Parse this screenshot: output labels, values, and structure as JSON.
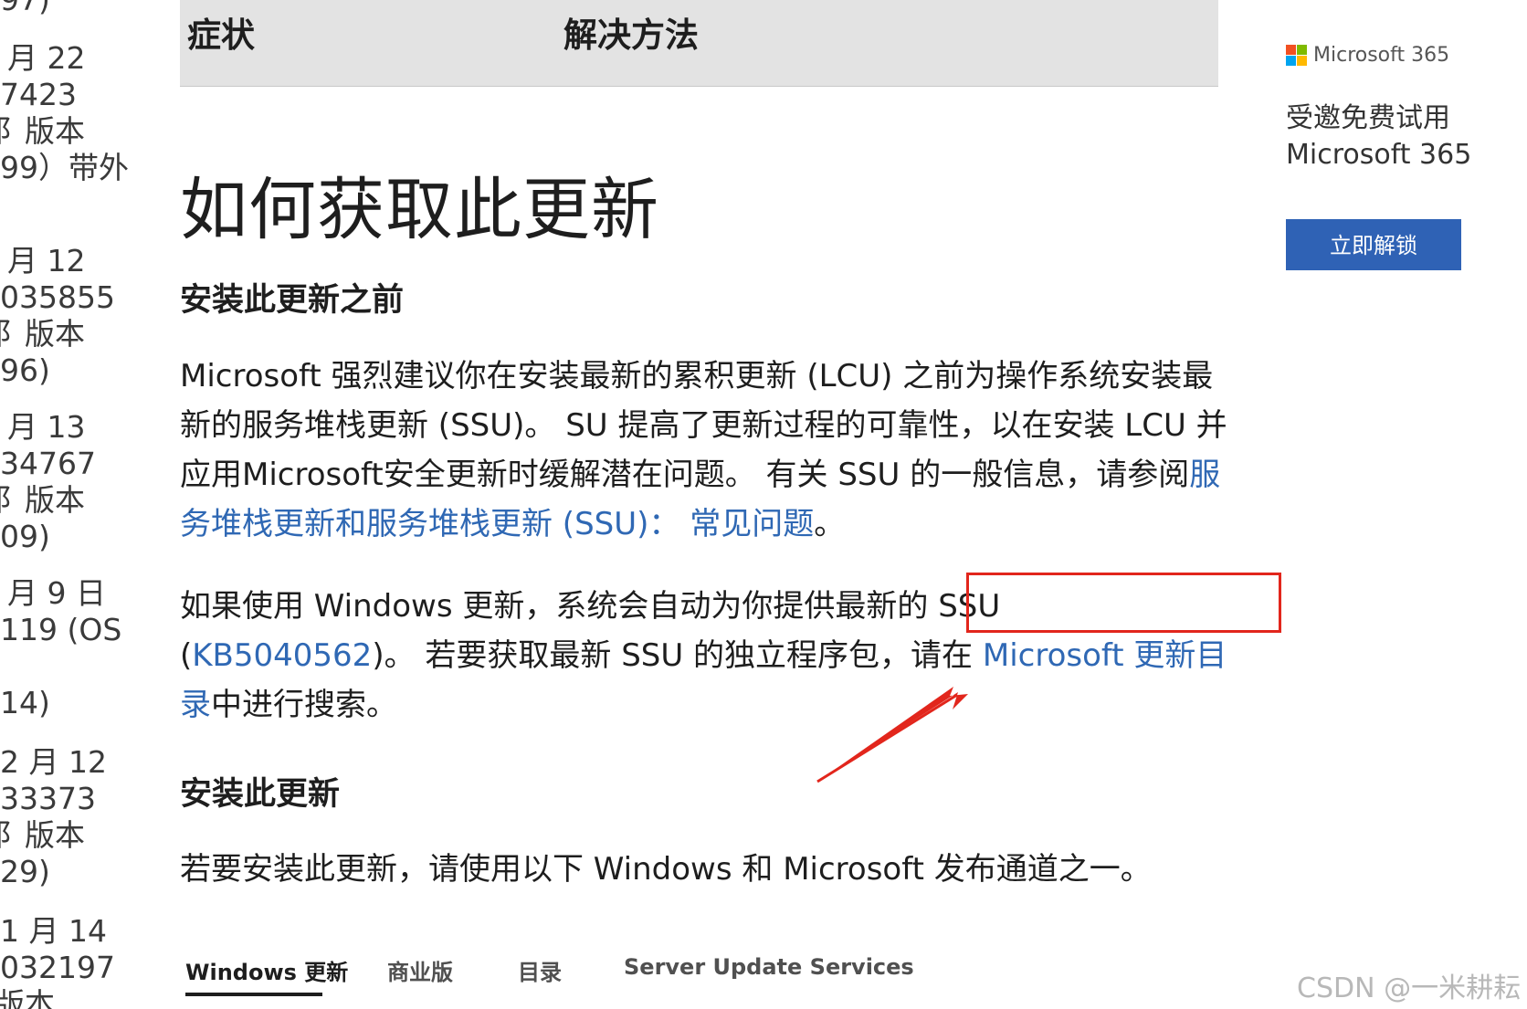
{
  "sidebar_fragments": [
    "97)",
    "月 22",
    "7423",
    "阝版本",
    "99）带外",
    "月 12",
    "035855",
    "阝版本",
    "96)",
    "月 13",
    "34767",
    "阝版本",
    "09)",
    "月 9 日",
    "119 (OS",
    "14)",
    "2 月 12",
    "33373",
    "阝版本",
    "29)",
    "1 月 14",
    "032197",
    "版本"
  ],
  "table_header": {
    "col1": "症状",
    "col2": "解决方法"
  },
  "heading": "如何获取此更新",
  "section1": {
    "title": "安装此更新之前",
    "p1_text": "Microsoft 强烈建议你在安装最新的累积更新 (LCU) 之前为操作系统安装最新的服务堆栈更新 (SSU)。 SU 提高了更新过程的可靠性，以在安装 LCU 并应用Microsoft安全更新时缓解潜在问题。 有关 SSU 的一般信息，请参阅",
    "p1_link": "服务堆栈更新和服务堆栈更新 (SSU)： 常见问题",
    "p1_end": "。",
    "p2_before": "如果使用 Windows 更新，系统会自动为你提供最新的 SSU (",
    "p2_kb": "KB5040562",
    "p2_mid": ")。 若要获取最新 SSU 的独立程序包，请在 ",
    "p2_link": "Microsoft 更新目录",
    "p2_end": "中进行搜索。"
  },
  "section2": {
    "title": "安装此更新",
    "text": "若要安装此更新，请使用以下 Windows 和 Microsoft 发布通道之一。"
  },
  "tabs": [
    "Windows 更新",
    "商业版",
    "目录",
    "Server Update Services"
  ],
  "ad": {
    "brand": "Microsoft 365",
    "line1": "受邀免费试用",
    "line2": "Microsoft 365",
    "button": "立即解锁"
  },
  "watermark": "CSDN @一米耕耘",
  "colors": {
    "link": "#2f68b4",
    "annotation": "#e2261c",
    "button": "#2f62b5"
  }
}
